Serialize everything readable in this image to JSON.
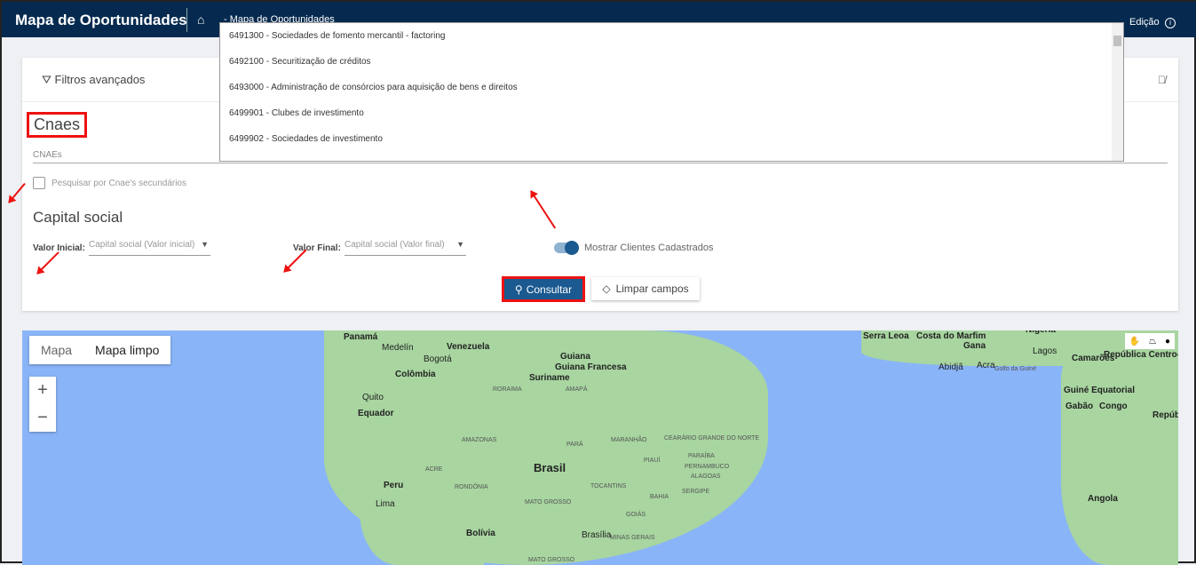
{
  "header": {
    "title": "Mapa de Oportunidades",
    "breadcrumb": "- Mapa de Oportunidades",
    "mode": "Edição"
  },
  "filters": {
    "title": "Filtros avançados",
    "cnaes_title": "Cnaes",
    "cnaes_label": "CNAEs",
    "secondary_label": "Pesquisar por Cnae's secundários",
    "secondary_checked": false,
    "capital_title": "Capital social",
    "initial_label": "Valor Inicial:",
    "initial_placeholder": "Capital social (Valor inicial)",
    "final_label": "Valor Final:",
    "final_placeholder": "Capital social (Valor final)",
    "toggle_label": "Mostrar Clientes Cadastrados",
    "toggle_on": true,
    "search_button": "Consultar",
    "clear_button": "Limpar campos"
  },
  "dropdown": {
    "options": [
      "6491300 - Sociedades de fomento mercantil - factoring",
      "6492100 - Securitização de créditos",
      "6493000 - Administração de consórcios para aquisição de bens e direitos",
      "6499901 - Clubes de investimento",
      "6499902 - Sociedades de investimento"
    ]
  },
  "map": {
    "tabs": [
      "Mapa",
      "Mapa limpo"
    ],
    "active_tab": "Mapa limpo",
    "zoom_in": "+",
    "zoom_out": "−",
    "labels": [
      "Panamá",
      "Medelín",
      "Venezuela",
      "Guiana",
      "Guiana Francesa",
      "Suriname",
      "Bogotá",
      "Colômbia",
      "RORAIMA",
      "AMAPÁ",
      "Quito",
      "Equador",
      "AMAZONAS",
      "PARÁ",
      "MARANHÃO",
      "CEARÁ",
      "RIO GRANDE DO NORTE",
      "PARAÍBA",
      "PERNAMBUCO",
      "ALAGOAS",
      "SERGIPE",
      "ACRE",
      "Brasil",
      "PIAUÍ",
      "RONDÔNIA",
      "TOCANTINS",
      "BAHIA",
      "Peru",
      "Lima",
      "MATO GROSSO",
      "GOIÁS",
      "Brasília",
      "MINAS GERAIS",
      "Bolívia",
      "MATO GROSSO",
      "Serra Leoa",
      "Costa do Marfim",
      "Gana",
      "Nigéria",
      "Abidjã",
      "Acra",
      "Golfo da Guiné",
      "Lagos",
      "Camarões",
      "República Centro-Africana",
      "Guiné Equatorial",
      "Gabão",
      "Congo",
      "República Democrática do Congo",
      "Angola"
    ]
  }
}
